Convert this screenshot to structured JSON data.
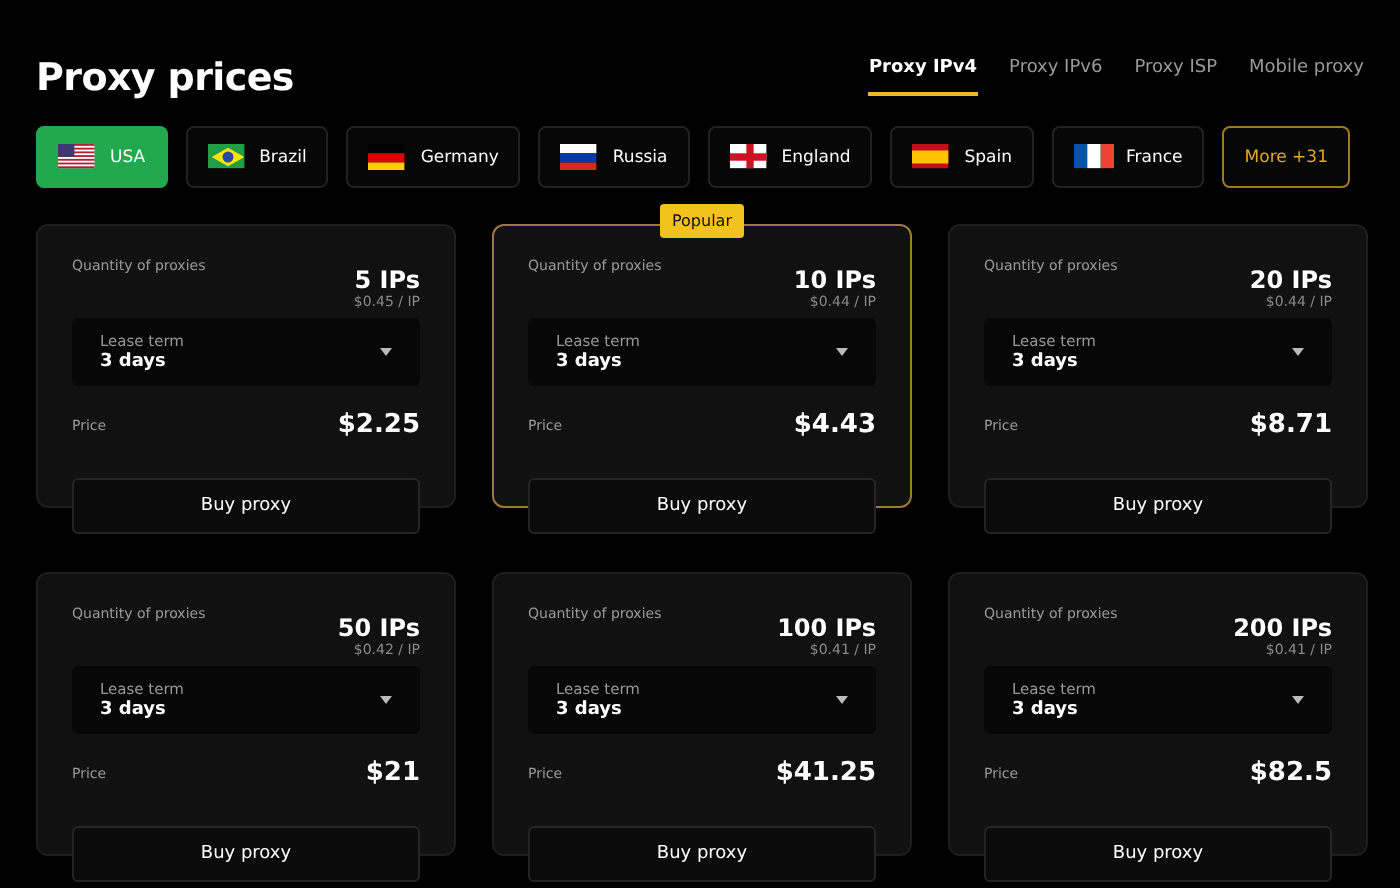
{
  "title": "Proxy prices",
  "tabs": [
    {
      "label": "Proxy IPv4",
      "selected": true
    },
    {
      "label": "Proxy IPv6",
      "selected": false
    },
    {
      "label": "Proxy ISP",
      "selected": false
    },
    {
      "label": "Mobile proxy",
      "selected": false
    }
  ],
  "countries": [
    {
      "label": "USA",
      "kind": "us",
      "selected": true
    },
    {
      "label": "Brazil",
      "kind": "br",
      "selected": false
    },
    {
      "label": "Germany",
      "kind": "de",
      "selected": false
    },
    {
      "label": "Russia",
      "kind": "ru",
      "selected": false
    },
    {
      "label": "England",
      "kind": "en",
      "selected": false
    },
    {
      "label": "Spain",
      "kind": "es",
      "selected": false
    },
    {
      "label": "France",
      "kind": "fr",
      "selected": false
    },
    {
      "label": "More +31",
      "kind": "more",
      "selected": false
    }
  ],
  "cards": [
    {
      "quantity_label": "Quantity of proxies",
      "quantity": "5 IPs",
      "unit_price": "$0.45 / IP",
      "lease_label": "Lease term",
      "lease": "3 days",
      "price_label": "Price",
      "price": "$2.25",
      "button": "Buy proxy",
      "highlighted": false
    },
    {
      "badge": "Popular",
      "quantity_label": "Quantity of proxies",
      "quantity": "10 IPs",
      "unit_price": "$0.44 / IP",
      "lease_label": "Lease term",
      "lease": "3 days",
      "price_label": "Price",
      "price": "$4.43",
      "button": "Buy proxy",
      "highlighted": true
    },
    {
      "quantity_label": "Quantity of proxies",
      "quantity": "20 IPs",
      "unit_price": "$0.44 / IP",
      "lease_label": "Lease term",
      "lease": "3 days",
      "price_label": "Price",
      "price": "$8.71",
      "button": "Buy proxy",
      "highlighted": false
    },
    {
      "quantity_label": "Quantity of proxies",
      "quantity": "50 IPs",
      "unit_price": "$0.42 / IP",
      "lease_label": "Lease term",
      "lease": "3 days",
      "price_label": "Price",
      "price": "$21",
      "button": "Buy proxy",
      "highlighted": false
    },
    {
      "quantity_label": "Quantity of proxies",
      "quantity": "100 IPs",
      "unit_price": "$0.41 / IP",
      "lease_label": "Lease term",
      "lease": "3 days",
      "price_label": "Price",
      "price": "$41.25",
      "button": "Buy proxy",
      "highlighted": false
    },
    {
      "quantity_label": "Quantity of proxies",
      "quantity": "200 IPs",
      "unit_price": "$0.41 / IP",
      "lease_label": "Lease term",
      "lease": "3 days",
      "price_label": "Price",
      "price": "$82.5",
      "button": "Buy proxy",
      "highlighted": false
    }
  ]
}
